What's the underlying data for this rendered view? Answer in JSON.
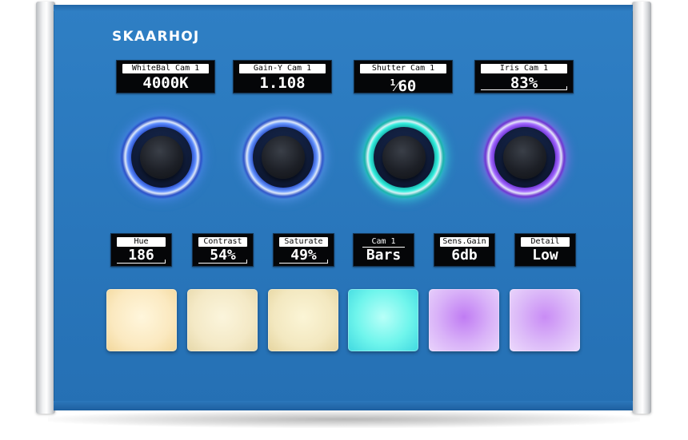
{
  "brand": "SKAARHOJ",
  "colors": {
    "panel": "#2a78bd",
    "enc_blue": "#3c6ff0",
    "enc_cyan": "#2ee6d8",
    "enc_purple": "#8a4cf2",
    "btn_warm": "#fdf1d2",
    "btn_cyan": "#6ff5ec",
    "btn_purple": "#d8b0f7"
  },
  "top_displays": [
    {
      "label": "WhiteBal Cam 1",
      "value": "4000K"
    },
    {
      "label": "Gain-Y Cam 1",
      "value": "1.108"
    },
    {
      "label": "Shutter Cam 1",
      "value": "60",
      "prefix": "1"
    },
    {
      "label": "Iris Cam 1",
      "value": "83%",
      "level": 0.83
    }
  ],
  "bottom_displays": [
    {
      "label": "Hue",
      "value": "186"
    },
    {
      "label": "Contrast",
      "value": "54%",
      "level": 0.54
    },
    {
      "label": "Saturate",
      "value": "49%",
      "level": 0.49
    },
    {
      "label": "Cam 1",
      "value": "Bars"
    },
    {
      "label": "Sens.Gain",
      "value": "6db"
    },
    {
      "label": "Detail",
      "value": "Low"
    }
  ],
  "encoders": [
    {
      "name": "encoder-1",
      "color": "blue"
    },
    {
      "name": "encoder-2",
      "color": "blue"
    },
    {
      "name": "encoder-3",
      "color": "cyan"
    },
    {
      "name": "encoder-4",
      "color": "purple"
    }
  ],
  "buttons": [
    {
      "color": "warm"
    },
    {
      "color": "warm"
    },
    {
      "color": "warm"
    },
    {
      "color": "cyan"
    },
    {
      "color": "purple"
    },
    {
      "color": "purple"
    }
  ]
}
